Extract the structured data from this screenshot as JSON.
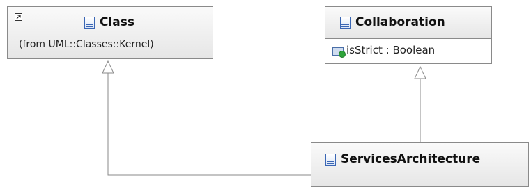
{
  "diagram": {
    "class_node": {
      "title": "Class",
      "subtitle": "(from UML::Classes::Kernel)"
    },
    "collaboration_node": {
      "title": "Collaboration",
      "attribute": "isStrict : Boolean"
    },
    "services_node": {
      "title": "ServicesArchitecture"
    },
    "relations": [
      {
        "from": "ServicesArchitecture",
        "to": "Class",
        "type": "generalization"
      },
      {
        "from": "ServicesArchitecture",
        "to": "Collaboration",
        "type": "generalization"
      }
    ]
  }
}
